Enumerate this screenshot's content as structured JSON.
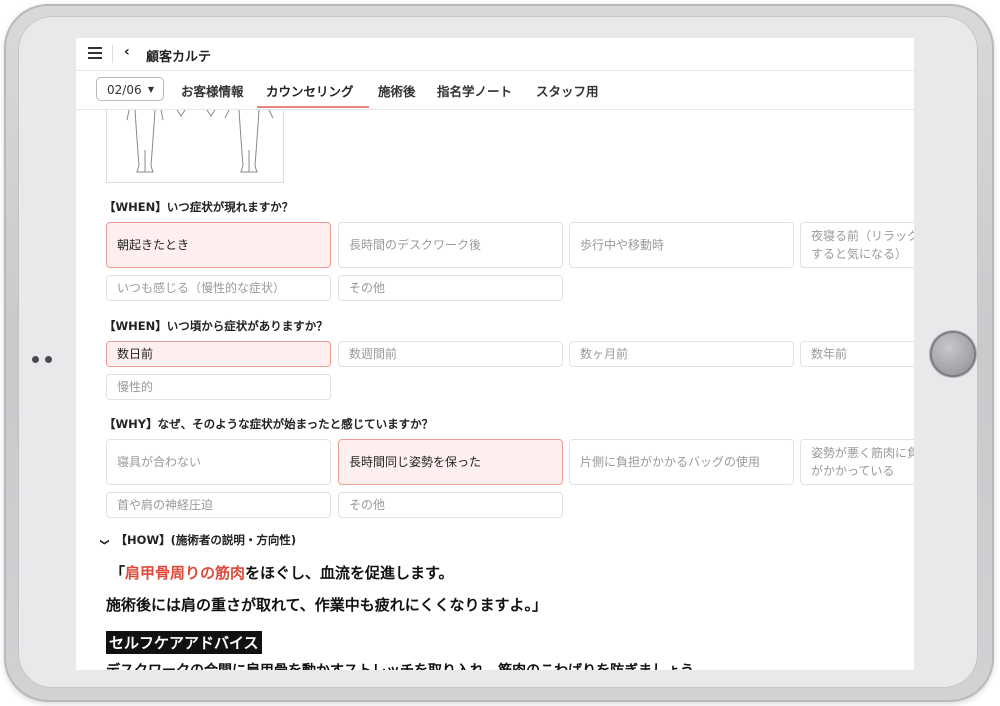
{
  "header": {
    "title": "顧客カルテ"
  },
  "date_select": {
    "value": "02/06"
  },
  "tabs": [
    {
      "label": "お客様情報"
    },
    {
      "label": "カウンセリング"
    },
    {
      "label": "施術後"
    },
    {
      "label": "指名学ノート"
    },
    {
      "label": "スタッフ用"
    }
  ],
  "questions": [
    {
      "title": "【WHEN】いつ症状が現れますか？",
      "options": [
        "朝起きたとき",
        "長時間のデスクワーク後",
        "歩行中や移動時",
        "夜寝る前（リラックスすると気になる）",
        "いつも感じる（慢性的な症状）",
        "その他"
      ]
    },
    {
      "title": "【WHEN】いつ頃から症状がありますか？",
      "options": [
        "数日前",
        "数週間前",
        "数ヶ月前",
        "数年前",
        "慢性的"
      ]
    },
    {
      "title": "【WHY】なぜ、そのような症状が始まったと感じていますか？",
      "options": [
        "寝具が合わない",
        "長時間同じ姿勢を保った",
        "片側に負担がかかるバッグの使用",
        "姿勢が悪く筋肉に負担がかかっている",
        "首や肩の神経圧迫",
        "その他"
      ]
    }
  ],
  "how": {
    "title": "【HOW】(施術者の説明・方向性)",
    "line1_prefix": "「",
    "line1_highlight": "肩甲骨周りの筋肉",
    "line1_suffix": "をほぐし、血流を促進します。",
    "line2": "施術後には肩の重さが取れて、作業中も疲れにくくなりますよ。」",
    "self_care_label": "セルフケアアドバイス",
    "line3": "デスクワークの合間に肩甲骨を動かすストレッチを取り入れ、筋肉のこわばりを防ぎましょう。"
  },
  "colors": {
    "accent": "#e8857c",
    "selected_bg": "#fff0ef",
    "highlight_text": "#e04a3c"
  }
}
